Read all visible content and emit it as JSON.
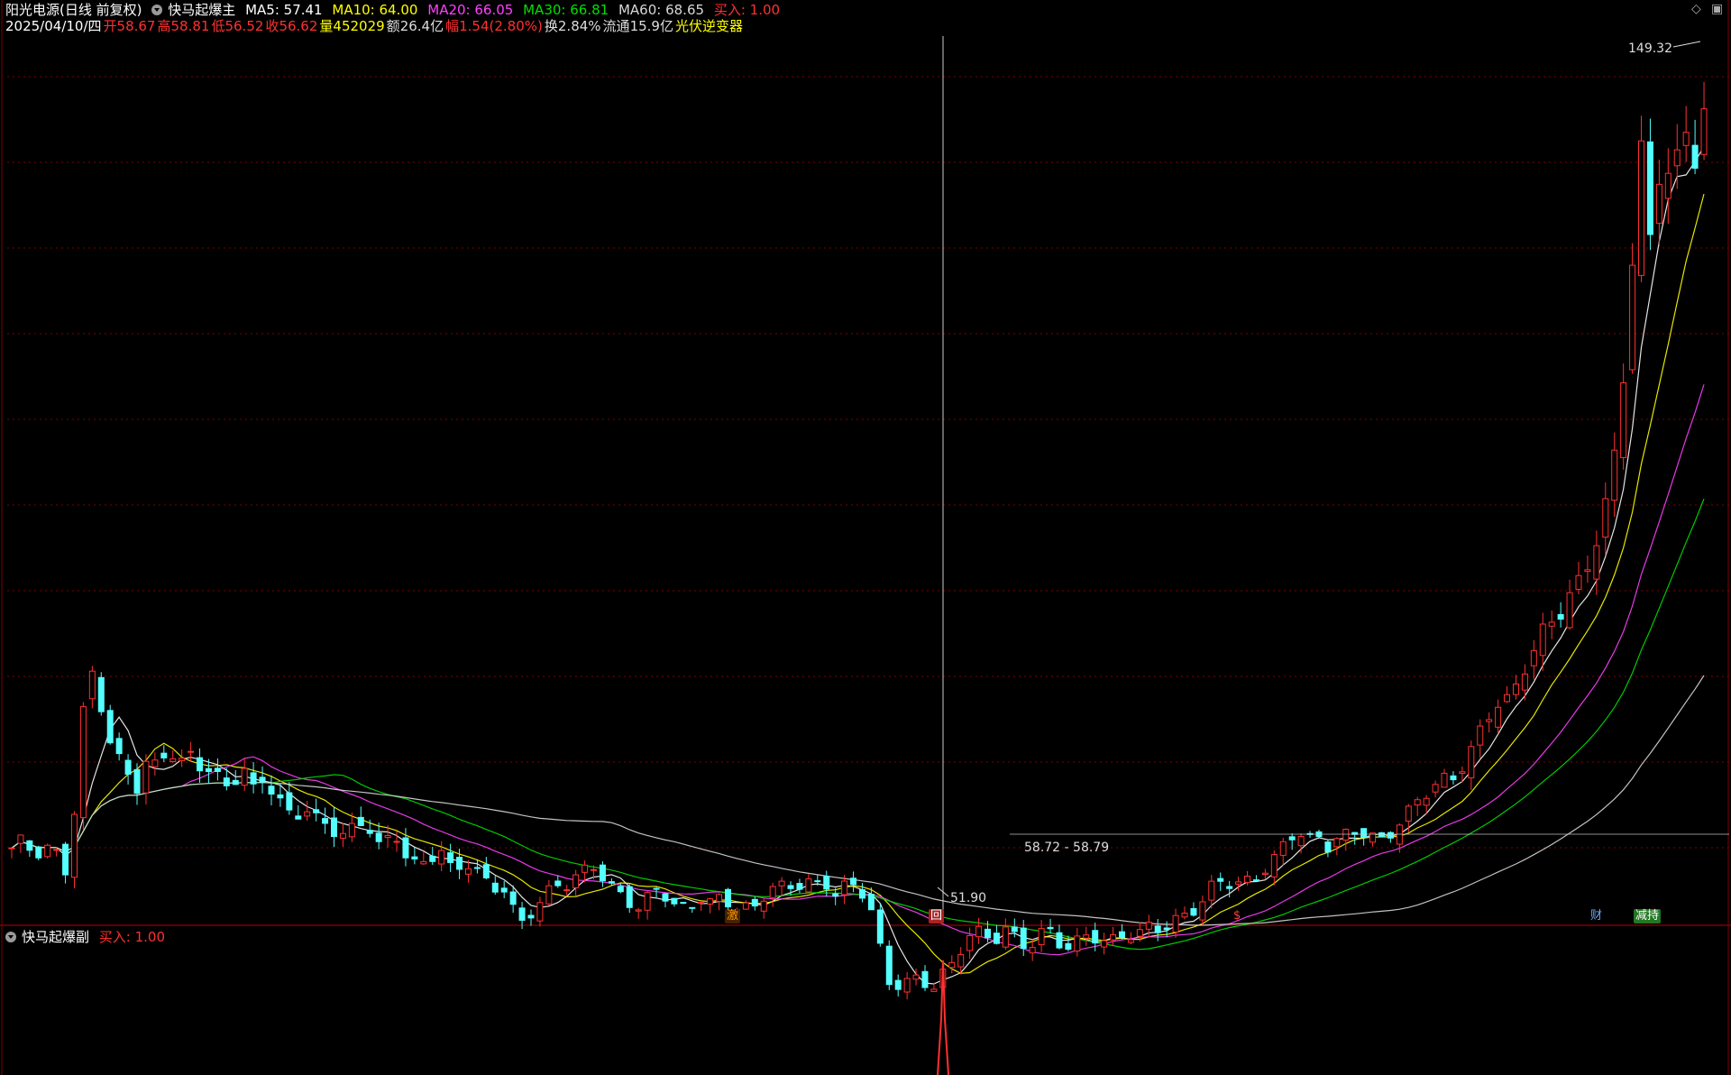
{
  "header": {
    "stock_name": "阳光电源",
    "period": "(日线 前复权)",
    "indicator": "快马起爆主",
    "ma": [
      {
        "label": "MA5: ",
        "value": "57.41",
        "color": "#ffffff"
      },
      {
        "label": "MA10: ",
        "value": "64.00",
        "color": "#ffff00"
      },
      {
        "label": "MA20: ",
        "value": "66.05",
        "color": "#ff40ff"
      },
      {
        "label": "MA30: ",
        "value": "66.81",
        "color": "#00e000"
      },
      {
        "label": "MA60: ",
        "value": "68.65",
        "color": "#d8d8d8"
      }
    ],
    "buy_label": "买入: ",
    "buy_value": "1.00",
    "date": "2025/04/10/四",
    "open_label": "开",
    "open": "58.67",
    "high_label": "高",
    "high": "58.81",
    "low_label": "低",
    "low": "56.52",
    "close_label": "收",
    "close": "56.62",
    "vol_label": "量",
    "vol": "452029",
    "amount_label": "额",
    "amount": "26.4亿",
    "chg_label": "幅",
    "chg": "1.54(2.80%)",
    "turnover_label": "换",
    "turnover": "2.84%",
    "float_label": "流通",
    "float": "15.9亿",
    "concept": "光伏逆变器"
  },
  "sub_panel": {
    "indicator": "快马起爆副",
    "buy_label": "买入: ",
    "buy_value": "1.00"
  },
  "annotations": {
    "max_label": "149.32",
    "min_label": "51.90",
    "range_label": "58.72 - 58.79"
  },
  "flags": [
    {
      "text": "激",
      "color": "#ff9900",
      "bg": "#442200"
    },
    {
      "text": "回",
      "color": "#ffffff",
      "bg": "#aa2222"
    },
    {
      "text": "$",
      "color": "#ff4040",
      "bg": "transparent"
    },
    {
      "text": "财",
      "color": "#66aaff",
      "bg": "transparent"
    },
    {
      "text": "减持",
      "color": "#ffffff",
      "bg": "#227722"
    }
  ],
  "colors": {
    "up": "#ff3030",
    "down": "#54ffff",
    "grid": "#800000",
    "crosshair": "#cccccc"
  },
  "chart_data": {
    "type": "candlestick",
    "title": "阳光电源",
    "ylim": [
      48,
      156
    ],
    "anchor_prices": [
      57,
      57.5,
      56,
      56,
      57,
      53,
      62,
      76,
      80,
      72,
      68,
      66,
      64,
      67,
      66,
      70,
      67,
      69,
      68,
      67,
      65,
      64,
      67,
      63,
      65,
      64,
      62,
      61,
      63,
      61,
      60,
      59,
      58,
      59,
      60,
      57,
      58,
      59,
      56,
      55,
      56,
      57,
      54,
      54,
      55,
      53,
      52,
      53,
      50,
      48,
      50,
      51,
      52,
      52,
      53,
      54,
      55,
      53,
      52,
      51,
      50,
      51,
      52,
      50,
      49,
      49.5,
      51,
      50.5,
      51.5,
      50.5,
      50,
      49.5,
      51,
      52,
      51.5,
      52,
      53,
      52.5,
      53,
      52,
      53,
      52,
      51,
      45,
      40,
      40,
      41,
      41,
      40,
      42,
      43,
      45,
      47,
      46,
      45,
      47,
      46,
      45,
      46,
      48,
      46,
      45,
      45.5,
      46,
      45.5,
      45,
      46,
      46.5,
      47,
      48,
      47.5,
      48,
      48.5,
      49,
      50,
      52,
      53,
      52.5,
      53,
      54,
      55,
      56,
      58,
      59,
      57,
      58,
      57,
      58,
      59,
      60,
      59,
      58,
      59,
      60,
      61,
      63,
      64,
      65,
      66,
      68,
      70,
      73,
      75,
      74,
      76,
      79,
      81,
      84,
      86,
      88,
      90,
      93,
      96,
      100,
      110,
      125,
      140,
      130,
      144,
      136,
      149,
      142,
      146
    ]
  }
}
